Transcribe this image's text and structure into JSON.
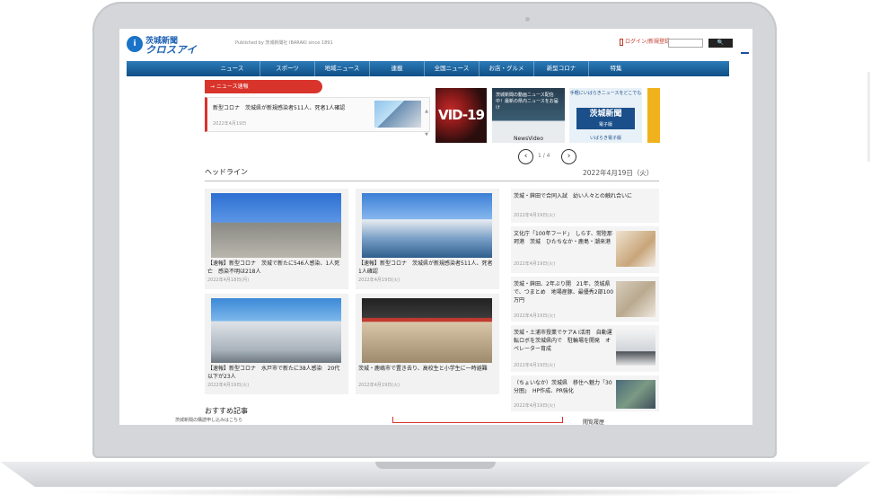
{
  "header": {
    "logo_top": "茨城新聞",
    "logo_bottom": "クロスアイ",
    "logo_mark": "i",
    "publisher": "Published by 茨城新聞社 IBARAKI since 1891",
    "login": "ログイン/新規登録",
    "search_placeholder": "",
    "search_button": "🔍"
  },
  "nav": [
    "ニュース",
    "スポーツ",
    "地域ニュース",
    "連載",
    "全国ニュース",
    "お店・グルメ",
    "新型コロナ",
    "特集"
  ],
  "news_flash": {
    "tab_label": "→ ニュース速報",
    "title": "新型コロナ　茨城県が新規感染者511人、死者1人確認",
    "time": "2022年4月19日"
  },
  "banners": {
    "covid": "VID-19",
    "video_text": "茨城新聞の動画ニュース配信中！最新の県内ニュースをお届け",
    "video_logo": "NewsVideo",
    "epaper_top": "手軽にいばらきニュースをどこでも",
    "epaper_title": "茨城新聞",
    "epaper_sub": "電子版",
    "epaper_bottom": "いばらき電子版"
  },
  "carousel": {
    "prev": "‹",
    "next": "›",
    "count": "1 / 4"
  },
  "headline": {
    "title": "ヘッドライン",
    "date": "2022年4月19日（火）"
  },
  "cards": [
    {
      "title": "【速報】新型コロナ　茨城で新たに546人感染、1人死亡　感染不明は218人",
      "date": "2022年4月18日(月)"
    },
    {
      "title": "【速報】新型コロナ　茨城県が新規感染者511人、死者1人確認",
      "date": "2022年4月19日(火)"
    },
    {
      "title": "【速報】新型コロナ　水戸市で新たに38人感染　20代以下が23人",
      "date": "2022年4月19日(火)"
    },
    {
      "title": "茨城・鹿嶋市で置き去り、高校生と小学生に一時避難",
      "date": "2022年4月19日(火)"
    }
  ],
  "side_items": [
    {
      "title": "茨城・鉾田で合同入試　幼い人々との触れ合いに",
      "date": "2022年4月19日(火)"
    },
    {
      "title": "文化庁「100年フード」　しらす、常陸那珂港　茨城　ひたちなか・鹿島・潮来港",
      "date": "2022年4月19日(火)"
    },
    {
      "title": "茨城・鉾田、2年ぶり開　21年、茨城県で、つまとめ　地場産豚、最優秀2部100万円",
      "date": "2022年4月19日(火)"
    },
    {
      "title": "茨城・土浦市授業でケアA I活用　自動運転ロボを茨城県内で　駐輪場を開発　オペレーター育成",
      "date": "2022年4月19日(火)"
    },
    {
      "title": "（ちょいなか）茨城県　移住へ魅力「30 分圏」　HP作成、PR強化",
      "date": "2022年4月19日(火)"
    }
  ],
  "recommend": {
    "title": "おすすめ記事",
    "text": "茨城新聞の購読申し込みはこちら",
    "history": "閲覧履歴"
  }
}
